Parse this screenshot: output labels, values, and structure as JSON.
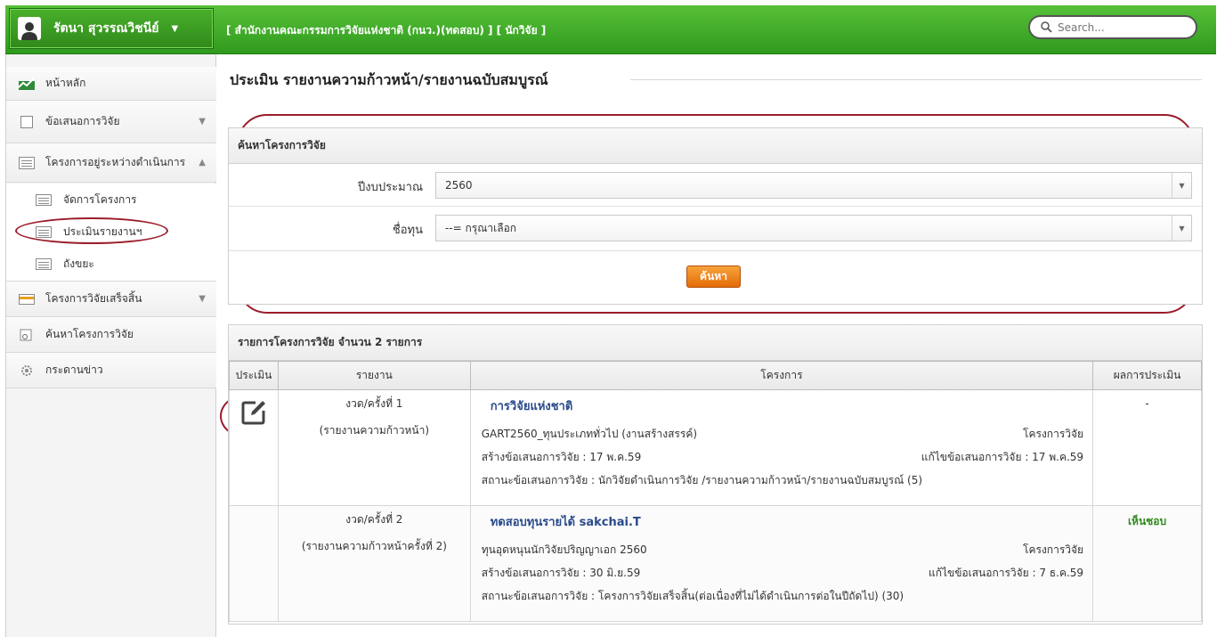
{
  "header": {
    "user_name": "รัตนา สุวรรณวิชนีย์",
    "org_text": "[ สำนักงานคณะกรรมการวิจัยแห่งชาติ (กนว.)(ทดสอบ) ] [ นักวิจัย ]",
    "search_placeholder": "Search..."
  },
  "sidebar": {
    "items": [
      {
        "label": "หน้าหลัก"
      },
      {
        "label": "ข้อเสนอการวิจัย"
      },
      {
        "label": "โครงการอยู่ระหว่างดำเนินการ"
      },
      {
        "label": "โครงการวิจัยเสร็จสิ้น"
      },
      {
        "label": "ค้นหาโครงการวิจัย"
      },
      {
        "label": "กระดานข่าว"
      }
    ],
    "subitems": [
      {
        "label": "จัดการโครงการ"
      },
      {
        "label": "ประเมินรายงานฯ"
      },
      {
        "label": "ถังขยะ"
      }
    ]
  },
  "main": {
    "page_title": "ประเมิน รายงานความก้าวหน้า/รายงานฉบับสมบูรณ์",
    "search_panel": {
      "title": "ค้นหาโครงการวิจัย",
      "year_label": "ปีงบประมาณ",
      "year_value": "2560",
      "fund_label": "ชื่อทุน",
      "fund_value": "--= กรุณาเลือก",
      "search_button": "ค้นหา"
    },
    "results": {
      "title": "รายการโครงการวิจัย จำนวน 2 รายการ",
      "columns": [
        "ประเมิน",
        "รายงาน",
        "โครงการ",
        "ผลการประเมิน"
      ],
      "rows": [
        {
          "report_round": "งวด/ครั้งที่ 1",
          "report_type": "(รายงานความก้าวหน้า)",
          "project_name": "การวิจัยแห่งชาติ",
          "fund": "GART2560_ทุนประเภททั่วไป (งานสร้างสรรค์)",
          "project_type": "โครงการวิจัย",
          "created": "สร้างข้อเสนอการวิจัย : 17 พ.ค.59",
          "edited": "แก้ไขข้อเสนอการวิจัย : 17 พ.ค.59",
          "status": "สถานะข้อเสนอการวิจัย : นักวิจัยดำเนินการวิจัย /รายงานความก้าวหน้า/รายงานฉบับสมบูรณ์ (5)",
          "result": "-"
        },
        {
          "report_round": "งวด/ครั้งที่ 2",
          "report_type": "(รายงานความก้าวหน้าครั้งที่ 2)",
          "project_name": "ทดสอบทุนรายได้ sakchai.T",
          "fund": "ทุนอุดหนุนนักวิจัยปริญญาเอก 2560",
          "project_type": "โครงการวิจัย",
          "created": "สร้างข้อเสนอการวิจัย : 30 มิ.ย.59",
          "edited": "แก้ไขข้อเสนอการวิจัย : 7 ธ.ค.59",
          "status": "สถานะข้อเสนอการวิจัย : โครงการวิจัยเสร็จสิ้น(ต่อเนื่องที่ไม่ได้ดำเนินการต่อในปีถัดไป) (30)",
          "result": "เห็นชอบ"
        }
      ]
    }
  }
}
